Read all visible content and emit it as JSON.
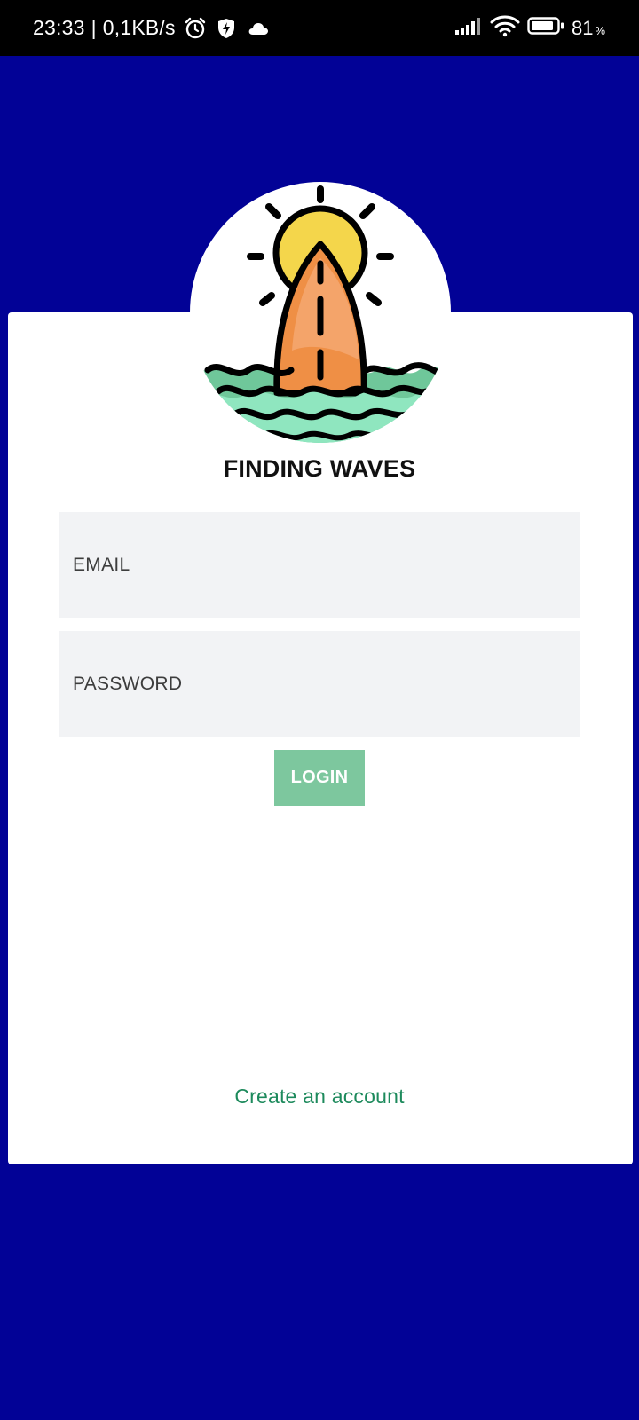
{
  "status_bar": {
    "time": "23:33",
    "separator": "|",
    "network_speed": "0,1KB/s",
    "icons_left": [
      "alarm-icon",
      "shield-bolt-icon",
      "cloud-icon"
    ],
    "icons_right": [
      "signal-icon",
      "wifi-icon",
      "battery-icon"
    ],
    "battery_level": "81",
    "battery_unit": "%"
  },
  "colors": {
    "background": "#020296",
    "status_bar": "#000000",
    "card": "#ffffff",
    "field_bg": "#f2f3f5",
    "login_button": "#7dc79e",
    "link": "#1d8a5c",
    "sun": "#f4d64b",
    "board": "#ef8f45",
    "wave_dark": "#6fc79a",
    "wave_light": "#8fe6bf"
  },
  "logo": {
    "icon": "sun-surfboard-waves-logo"
  },
  "brand": {
    "title": "FINDING WAVES"
  },
  "form": {
    "email_placeholder": "EMAIL",
    "password_placeholder": "PASSWORD",
    "login_label": "LOGIN"
  },
  "footer": {
    "create_account_label": "Create an account"
  }
}
